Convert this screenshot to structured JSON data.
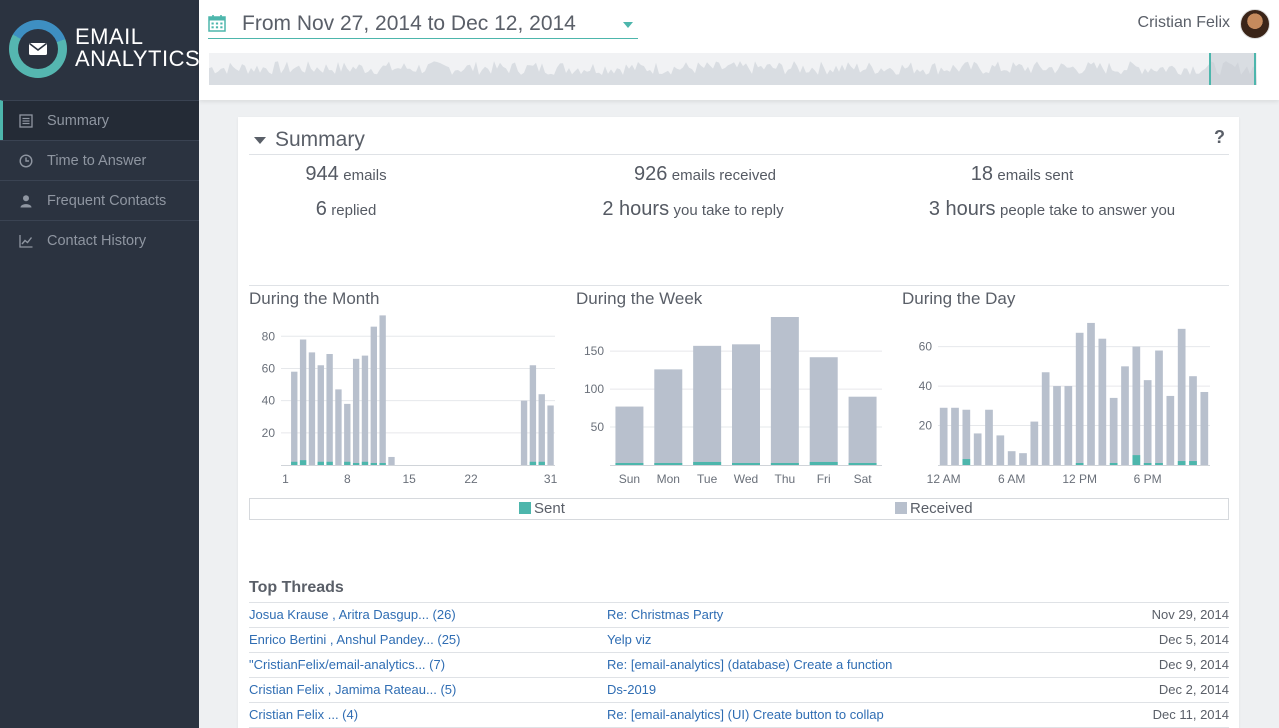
{
  "app": {
    "logo_line1": "EMAIL",
    "logo_line2": "ANALYTICS"
  },
  "sidebar": {
    "items": [
      {
        "label": "Summary",
        "icon": "list-icon",
        "active": true
      },
      {
        "label": "Time to Answer",
        "icon": "clock-icon",
        "active": false
      },
      {
        "label": "Frequent Contacts",
        "icon": "person-icon",
        "active": false
      },
      {
        "label": "Contact History",
        "icon": "line-chart-icon",
        "active": false
      }
    ]
  },
  "header": {
    "date_range": "From Nov 27, 2014 to Dec 12, 2014",
    "user_name": "Cristian Felix"
  },
  "summary": {
    "title": "Summary",
    "help": "?",
    "stats": [
      {
        "num": "944",
        "label": "emails"
      },
      {
        "num": "926",
        "label": "emails received"
      },
      {
        "num": "18",
        "label": "emails sent"
      },
      {
        "num": "6",
        "label": "replied"
      },
      {
        "num": "2 hours",
        "label": "you take to reply"
      },
      {
        "num": "3 hours",
        "label": "people take to answer you"
      }
    ]
  },
  "legend": {
    "sent": "Sent",
    "received": "Received"
  },
  "colors": {
    "sent": "#4db6ac",
    "received": "#b8c0cd",
    "accent": "#4db6ac",
    "link": "#2f6db3"
  },
  "chart_data": [
    {
      "type": "bar",
      "title": "During the Month",
      "x": [
        1,
        2,
        3,
        4,
        5,
        6,
        7,
        8,
        9,
        10,
        11,
        12,
        13,
        14,
        15,
        16,
        17,
        18,
        19,
        20,
        21,
        22,
        23,
        24,
        25,
        26,
        27,
        28,
        29,
        30,
        31
      ],
      "xtick_labels": [
        "1",
        "8",
        "15",
        "22",
        "31"
      ],
      "xticks": [
        1,
        8,
        15,
        22,
        31
      ],
      "ylim": [
        0,
        92
      ],
      "yticks": [
        20,
        40,
        60,
        80
      ],
      "series": [
        {
          "name": "Received",
          "values": [
            0,
            58,
            78,
            70,
            62,
            69,
            47,
            38,
            66,
            68,
            86,
            93,
            5,
            0,
            0,
            0,
            0,
            0,
            0,
            0,
            0,
            0,
            0,
            0,
            0,
            0,
            0,
            40,
            62,
            44,
            37
          ]
        },
        {
          "name": "Sent",
          "values": [
            0,
            2,
            3,
            0,
            2,
            2,
            0,
            2,
            1,
            2,
            1,
            1,
            0,
            0,
            0,
            0,
            0,
            0,
            0,
            0,
            0,
            0,
            0,
            0,
            0,
            0,
            0,
            0,
            2,
            2,
            0
          ]
        }
      ]
    },
    {
      "type": "bar",
      "title": "During the Week",
      "categories": [
        "Sun",
        "Mon",
        "Tue",
        "Wed",
        "Thu",
        "Fri",
        "Sat"
      ],
      "ylim": [
        0,
        195
      ],
      "yticks": [
        50,
        100,
        150
      ],
      "series": [
        {
          "name": "Received",
          "values": [
            77,
            126,
            157,
            159,
            195,
            142,
            90
          ]
        },
        {
          "name": "Sent",
          "values": [
            2,
            1,
            4,
            1,
            1,
            4,
            1
          ]
        }
      ]
    },
    {
      "type": "bar",
      "title": "During the Day",
      "x": [
        0,
        1,
        2,
        3,
        4,
        5,
        6,
        7,
        8,
        9,
        10,
        11,
        12,
        13,
        14,
        15,
        16,
        17,
        18,
        19,
        20,
        21,
        22,
        23
      ],
      "xtick_labels": [
        "12 AM",
        "6 AM",
        "12 PM",
        "6 PM"
      ],
      "xticks": [
        0,
        6,
        12,
        18
      ],
      "ylim": [
        0,
        75
      ],
      "yticks": [
        20,
        40,
        60
      ],
      "series": [
        {
          "name": "Received",
          "values": [
            29,
            29,
            28,
            16,
            28,
            15,
            7,
            6,
            22,
            47,
            40,
            40,
            67,
            72,
            64,
            34,
            50,
            60,
            43,
            58,
            35,
            69,
            45,
            37
          ]
        },
        {
          "name": "Sent",
          "values": [
            0,
            0,
            3,
            0,
            0,
            0,
            0,
            0,
            0,
            0,
            0,
            0,
            1,
            0,
            0,
            1,
            0,
            5,
            1,
            1,
            0,
            2,
            2,
            0
          ]
        }
      ]
    }
  ],
  "threads": {
    "title": "Top Threads",
    "rows": [
      {
        "people": "Josua Krause , Aritra Dasgup... (26)",
        "subject": "Re: Christmas Party",
        "date": "Nov 29, 2014"
      },
      {
        "people": "Enrico Bertini , Anshul Pandey... (25)",
        "subject": "Yelp viz",
        "date": "Dec 5, 2014"
      },
      {
        "people": "\"CristianFelix/email-analytics... (7)",
        "subject": "Re: [email-analytics] (database) Create a function",
        "date": "Dec 9, 2014"
      },
      {
        "people": "Cristian Felix , Jamima Rateau... (5)",
        "subject": "Ds-2019",
        "date": "Dec 2, 2014"
      },
      {
        "people": "Cristian Felix ... (4)",
        "subject": "Re: [email-analytics] (UI) Create button to collap",
        "date": "Dec 11, 2014"
      }
    ]
  }
}
